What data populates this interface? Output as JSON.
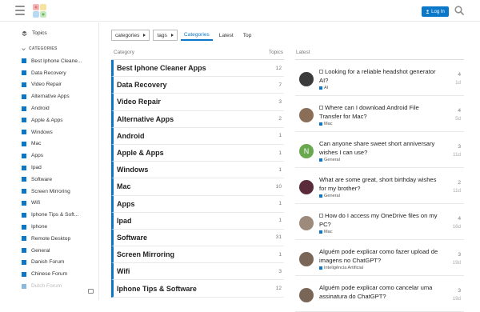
{
  "header": {
    "login_label": "Log In"
  },
  "sidebar": {
    "topics_label": "Topics",
    "section_label": "CATEGORIES",
    "items": [
      {
        "label": "Best Iphone Cleane..."
      },
      {
        "label": "Data Recovery"
      },
      {
        "label": "Video Repair"
      },
      {
        "label": "Alternative Apps"
      },
      {
        "label": "Android"
      },
      {
        "label": "Apple & Apps"
      },
      {
        "label": "Windows"
      },
      {
        "label": "Mac"
      },
      {
        "label": "Apps"
      },
      {
        "label": "Ipad"
      },
      {
        "label": "Software"
      },
      {
        "label": "Screen Mirroring"
      },
      {
        "label": "Wifi"
      },
      {
        "label": "Iphone Tips & Soft..."
      },
      {
        "label": "Iphone"
      },
      {
        "label": "Remote Desktop"
      },
      {
        "label": "General"
      },
      {
        "label": "Danish Forum"
      },
      {
        "label": "Chinese Forum"
      },
      {
        "label": "Dutch Forum"
      }
    ]
  },
  "nav": {
    "categories_dropdown": "categories",
    "tags_dropdown": "tags",
    "tabs": [
      "Categories",
      "Latest",
      "Top"
    ]
  },
  "categories": {
    "header_category": "Category",
    "header_topics": "Topics",
    "rows": [
      {
        "name": "Best Iphone Cleaner Apps",
        "topics": "12"
      },
      {
        "name": "Data Recovery",
        "topics": "7"
      },
      {
        "name": "Video Repair",
        "topics": "3"
      },
      {
        "name": "Alternative Apps",
        "topics": "2"
      },
      {
        "name": "Android",
        "topics": "1"
      },
      {
        "name": "Apple & Apps",
        "topics": "1"
      },
      {
        "name": "Windows",
        "topics": "1"
      },
      {
        "name": "Mac",
        "topics": "10"
      },
      {
        "name": "Apps",
        "topics": "1"
      },
      {
        "name": "Ipad",
        "topics": "1"
      },
      {
        "name": "Software",
        "topics": "31"
      },
      {
        "name": "Screen Mirroring",
        "topics": "1"
      },
      {
        "name": "Wifi",
        "topics": "3"
      },
      {
        "name": "Iphone Tips & Software",
        "topics": "12"
      }
    ]
  },
  "latest": {
    "header": "Latest",
    "topics": [
      {
        "title": "Looking for a reliable headshot generator AI?",
        "category": "AI",
        "replies": "4",
        "age": "1d",
        "pinned": true,
        "avatar_color": "#3b3b3b"
      },
      {
        "title": "Where can I download Android File Transfer for Mac?",
        "category": "Mac",
        "replies": "4",
        "age": "5d",
        "pinned": true,
        "avatar_color": "#8a6e58"
      },
      {
        "title": "Can anyone share sweet short anniversary wishes I can use?",
        "category": "General",
        "replies": "3",
        "age": "11d",
        "pinned": false,
        "avatar_color": "#6aa84f",
        "avatar_letter": "N"
      },
      {
        "title": "What are some great, short birthday wishes for my brother?",
        "category": "General",
        "replies": "2",
        "age": "11d",
        "pinned": false,
        "avatar_color": "#5a2b3a"
      },
      {
        "title": "How do I access my OneDrive files on my PC?",
        "category": "Mac",
        "replies": "4",
        "age": "16d",
        "pinned": true,
        "avatar_color": "#9c8a7a"
      },
      {
        "title": "Alguém pode explicar como fazer upload de imagens no ChatGPT?",
        "category": "Inteligência Artificial",
        "replies": "3",
        "age": "19d",
        "pinned": false,
        "avatar_color": "#7a6656"
      },
      {
        "title": "Alguém pode explicar como cancelar uma assinatura do ChatGPT?",
        "category": "",
        "replies": "3",
        "age": "19d",
        "pinned": false,
        "avatar_color": "#7a6656"
      }
    ]
  }
}
